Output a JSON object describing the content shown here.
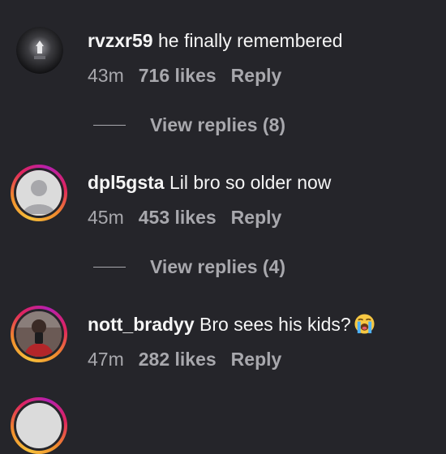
{
  "comments": [
    {
      "username": "rvzxr59",
      "text": "he finally remembered",
      "time": "43m",
      "likes": "716 likes",
      "reply": "Reply",
      "view_replies": "View replies (8)"
    },
    {
      "username": "dpl5gsta",
      "text": "Lil bro so older now",
      "time": "45m",
      "likes": "453 likes",
      "reply": "Reply",
      "view_replies": "View replies (4)"
    },
    {
      "username": "nott_bradyy",
      "text": "Bro sees his kids?",
      "emoji": "loudly-crying-face-icon",
      "time": "47m",
      "likes": "282 likes",
      "reply": "Reply"
    }
  ],
  "colors": {
    "background": "#25252a",
    "primary_text": "#f5f5f5",
    "secondary_text": "#a8a8ad",
    "story_ring": [
      "#f6c03b",
      "#e0245e",
      "#b41fb0"
    ]
  }
}
